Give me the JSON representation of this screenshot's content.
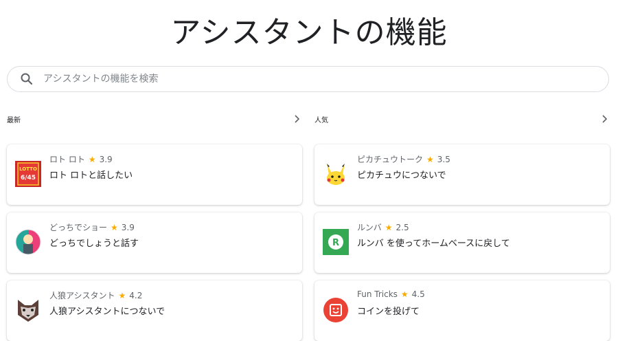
{
  "page": {
    "title": "アシスタントの機能"
  },
  "search": {
    "placeholder": "アシスタントの機能を検索"
  },
  "sections": [
    {
      "label": "最新",
      "cards": [
        {
          "name": "ロト ロト",
          "rating": "3.9",
          "phrase": "ロト ロトと話したい",
          "icon": "lotto-icon"
        },
        {
          "name": "どっちでショー",
          "rating": "3.9",
          "phrase": "どっちでしょうと話す",
          "icon": "dotchi-show-icon"
        },
        {
          "name": "人狼アシスタント",
          "rating": "4.2",
          "phrase": "人狼アシスタントにつないで",
          "icon": "wolf-icon"
        }
      ]
    },
    {
      "label": "人気",
      "cards": [
        {
          "name": "ピカチュウトーク",
          "rating": "3.5",
          "phrase": "ピカチュウにつないで",
          "icon": "pikachu-icon"
        },
        {
          "name": "ルンバ",
          "rating": "2.5",
          "phrase": "ルンバ を使ってホームベースに戻して",
          "icon": "roomba-icon"
        },
        {
          "name": "Fun Tricks",
          "rating": "4.5",
          "phrase": "コインを投げて",
          "icon": "fun-tricks-icon"
        }
      ]
    }
  ],
  "lotto_logo": {
    "line1": "LOTTO",
    "line2": "6/45"
  },
  "colors": {
    "star": "#f9ab00",
    "lotto": "#d32f2f",
    "roomba": "#34a853",
    "fun_tricks": "#ea4335"
  }
}
